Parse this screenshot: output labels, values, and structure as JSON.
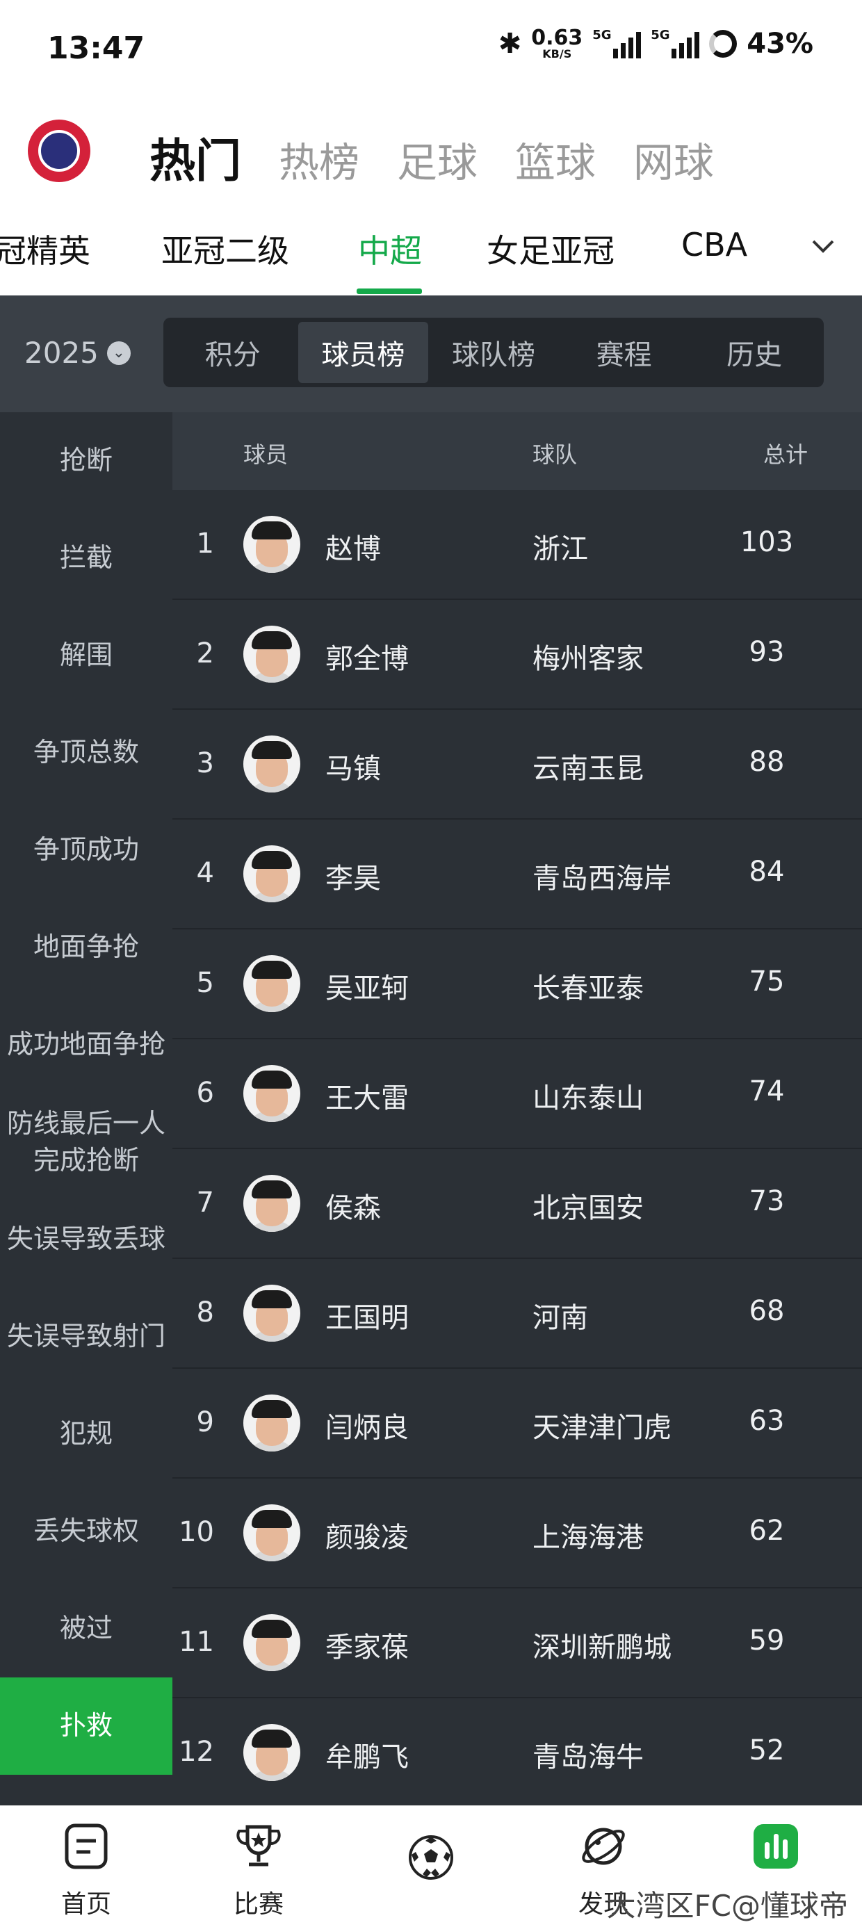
{
  "status_bar": {
    "time": "13:47",
    "net_speed": "0.63",
    "net_unit": "KB/S",
    "sig1": "5G",
    "sig2": "5G",
    "battery": "43%"
  },
  "top_nav": {
    "tabs": [
      "热门",
      "热榜",
      "足球",
      "篮球",
      "网球"
    ],
    "active_index": 0
  },
  "leagues": {
    "items": [
      "冠精英",
      "亚冠二级",
      "中超",
      "女足亚冠",
      "CBA"
    ],
    "active_index": 2
  },
  "filter": {
    "season": "2025",
    "segments": [
      "积分",
      "球员榜",
      "球队榜",
      "赛程",
      "历史"
    ],
    "active_index": 1
  },
  "categories": [
    {
      "label": "抢断"
    },
    {
      "label": "拦截"
    },
    {
      "label": "解围"
    },
    {
      "label": "争顶总数"
    },
    {
      "label": "争顶成功"
    },
    {
      "label": "地面争抢"
    },
    {
      "label": "成功地面争抢"
    },
    {
      "label": "防线最后一人\n完成抢断"
    },
    {
      "label": "失误导致丢球"
    },
    {
      "label": "失误导致射门"
    },
    {
      "label": "犯规"
    },
    {
      "label": "丢失球权"
    },
    {
      "label": "被过"
    },
    {
      "label": "扑救"
    }
  ],
  "active_category": "扑救",
  "table": {
    "headers": {
      "player": "球员",
      "team": "球队",
      "total": "总计"
    },
    "rows": [
      {
        "rank": "1",
        "name": "赵博",
        "team": "浙江",
        "total": "103"
      },
      {
        "rank": "2",
        "name": "郭全博",
        "team": "梅州客家",
        "total": "93"
      },
      {
        "rank": "3",
        "name": "马镇",
        "team": "云南玉昆",
        "total": "88"
      },
      {
        "rank": "4",
        "name": "李昊",
        "team": "青岛西海岸",
        "total": "84"
      },
      {
        "rank": "5",
        "name": "吴亚轲",
        "team": "长春亚泰",
        "total": "75"
      },
      {
        "rank": "6",
        "name": "王大雷",
        "team": "山东泰山",
        "total": "74"
      },
      {
        "rank": "7",
        "name": "侯森",
        "team": "北京国安",
        "total": "73"
      },
      {
        "rank": "8",
        "name": "王国明",
        "team": "河南",
        "total": "68"
      },
      {
        "rank": "9",
        "name": "闫炳良",
        "team": "天津津门虎",
        "total": "63"
      },
      {
        "rank": "10",
        "name": "颜骏凌",
        "team": "上海海港",
        "total": "62"
      },
      {
        "rank": "11",
        "name": "季家葆",
        "team": "深圳新鹏城",
        "total": "59"
      },
      {
        "rank": "12",
        "name": "牟鹏飞",
        "team": "青岛海牛",
        "total": "52"
      }
    ]
  },
  "bottom_nav": {
    "items": [
      {
        "label": "首页",
        "icon": "home-icon"
      },
      {
        "label": "比赛",
        "icon": "trophy-icon"
      },
      {
        "label": "",
        "icon": "football-icon"
      },
      {
        "label": "发现",
        "icon": "planet-icon"
      },
      {
        "label": "数据",
        "icon": "data-chart-icon"
      }
    ],
    "watermark": "大湾区FC@懂球帝"
  },
  "colors": {
    "accent": "#1fae44",
    "dark_bg": "#2b3036",
    "header_bg": "#3a4047"
  }
}
